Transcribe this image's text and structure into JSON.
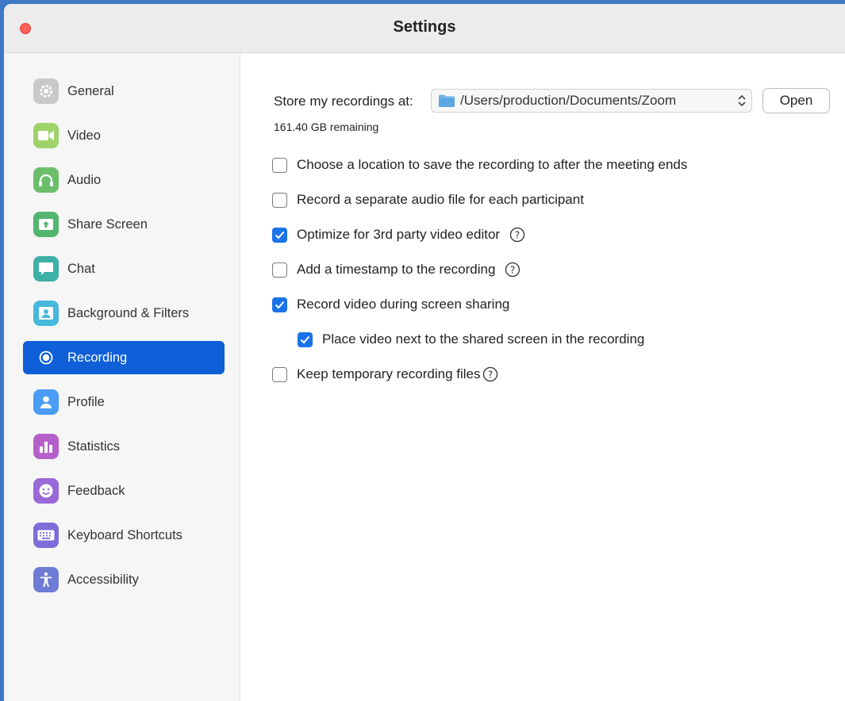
{
  "window": {
    "title": "Settings"
  },
  "sidebar": {
    "items": [
      {
        "label": "General",
        "icon": "gear-icon",
        "color": "#c9c9c9",
        "active": false
      },
      {
        "label": "Video",
        "icon": "video-camera-icon",
        "color": "#9ed36a",
        "active": false
      },
      {
        "label": "Audio",
        "icon": "headphones-icon",
        "color": "#6bbf6b",
        "active": false
      },
      {
        "label": "Share Screen",
        "icon": "share-screen-icon",
        "color": "#52b66f",
        "active": false
      },
      {
        "label": "Chat",
        "icon": "chat-icon",
        "color": "#3fb0a6",
        "active": false
      },
      {
        "label": "Background & Filters",
        "icon": "background-portrait-icon",
        "color": "#47b7dc",
        "active": false
      },
      {
        "label": "Recording",
        "icon": "record-icon",
        "color": "#0e5fd8",
        "active": true
      },
      {
        "label": "Profile",
        "icon": "person-icon",
        "color": "#4b9cf5",
        "active": false
      },
      {
        "label": "Statistics",
        "icon": "bar-chart-icon",
        "color": "#b560c9",
        "active": false
      },
      {
        "label": "Feedback",
        "icon": "smiley-icon",
        "color": "#9a68d8",
        "active": false
      },
      {
        "label": "Keyboard Shortcuts",
        "icon": "keyboard-icon",
        "color": "#7f6cd9",
        "active": false
      },
      {
        "label": "Accessibility",
        "icon": "accessibility-icon",
        "color": "#6e7cd6",
        "active": false
      }
    ]
  },
  "recording": {
    "store_label": "Store my recordings at:",
    "path_value": "/Users/production/Documents/Zoom",
    "open_label": "Open",
    "remaining": "161.40 GB remaining",
    "options": [
      {
        "label": "Choose a location to save the recording to after the meeting ends",
        "checked": false,
        "help": false,
        "indent": false
      },
      {
        "label": "Record a separate audio file for each participant",
        "checked": false,
        "help": false,
        "indent": false
      },
      {
        "label": "Optimize for 3rd party video editor",
        "checked": true,
        "help": true,
        "indent": false
      },
      {
        "label": "Add a timestamp to the recording",
        "checked": false,
        "help": true,
        "indent": false
      },
      {
        "label": "Record video during screen sharing",
        "checked": true,
        "help": false,
        "indent": false
      },
      {
        "label": "Place video next to the shared screen in the recording",
        "checked": true,
        "help": false,
        "indent": true
      },
      {
        "label": "Keep temporary recording files",
        "checked": false,
        "help": true,
        "indent": false
      }
    ]
  },
  "colors": {
    "accent": "#0e5fd8",
    "checkbox": "#1a73e8",
    "desktop": "#3e78c5"
  }
}
